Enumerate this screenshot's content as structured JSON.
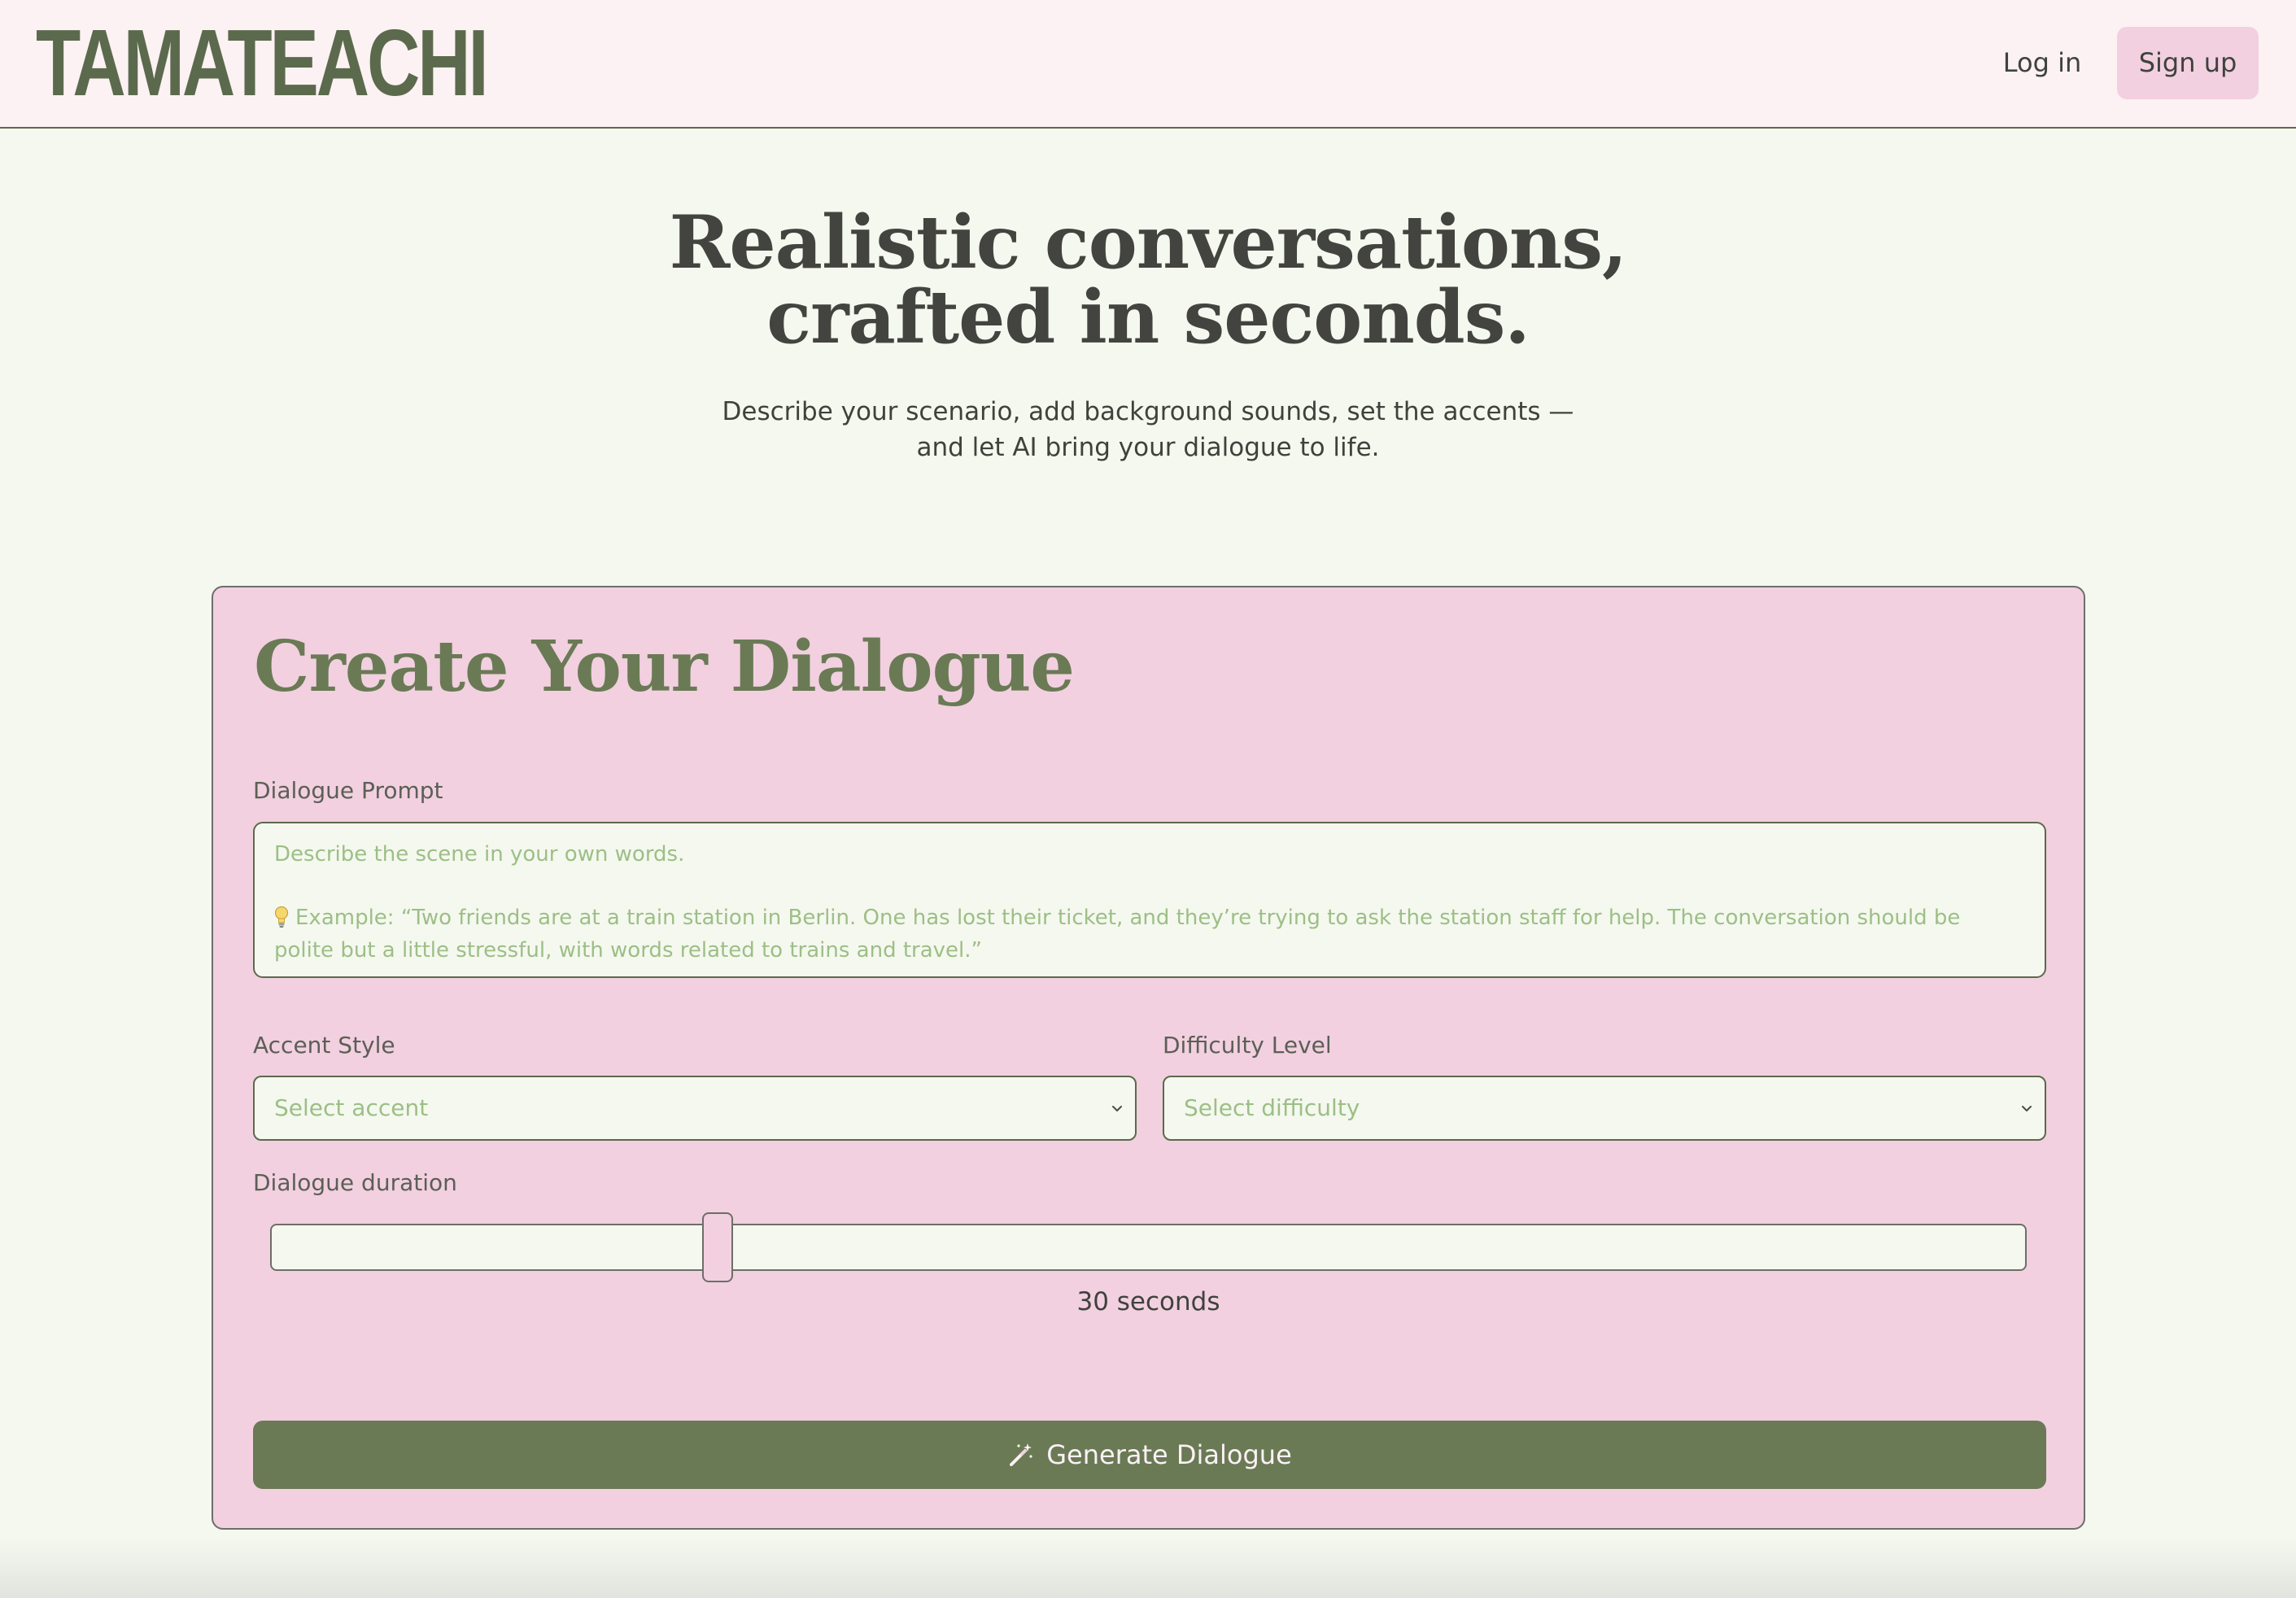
{
  "navbar": {
    "logo": "TAMATEACHI",
    "login_label": "Log in",
    "signup_label": "Sign up"
  },
  "hero": {
    "title_line1": "Realistic conversations,",
    "title_line2": "crafted in seconds.",
    "subtitle_line1": "Describe your scenario, add background sounds, set the accents —",
    "subtitle_line2": "and let AI bring your dialogue to life."
  },
  "form": {
    "title": "Create Your Dialogue",
    "prompt": {
      "label": "Dialogue Prompt",
      "value": "",
      "placeholder_line1": "Describe the scene in your own words.",
      "placeholder_example": "Example: “Two friends are at a train station in Berlin. One has lost their ticket, and they’re trying to ask the station staff for help. The conversation should be polite but a little stressful, with words related to trains and travel.”"
    },
    "accent": {
      "label": "Accent Style",
      "selected": "Select accent"
    },
    "difficulty": {
      "label": "Difficulty Level",
      "selected": "Select difficulty"
    },
    "duration": {
      "label": "Dialogue duration",
      "slider_fraction": 0.25,
      "readout": "30 seconds"
    },
    "generate_label": "Generate Dialogue"
  },
  "icons": {
    "prompt_hint": "lightbulb-icon",
    "select_arrow": "chevron-down-icon",
    "generate": "magic-wand-icon"
  },
  "colors": {
    "accent_green": "#6a7a55",
    "pink": "#f2d0e0",
    "background": "#f5f8ef",
    "navbar_background": "#fcf1f3",
    "placeholder_green": "#9cbf86"
  }
}
